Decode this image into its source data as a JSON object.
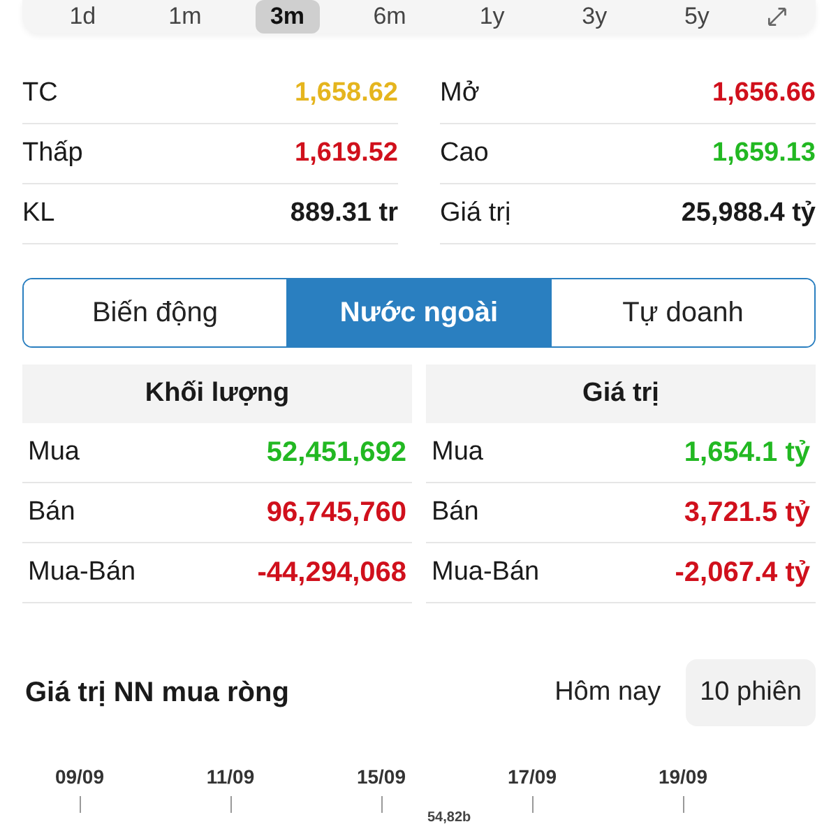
{
  "periods": [
    {
      "label": "1d",
      "selected": false
    },
    {
      "label": "1m",
      "selected": false
    },
    {
      "label": "3m",
      "selected": true
    },
    {
      "label": "6m",
      "selected": false
    },
    {
      "label": "1y",
      "selected": false
    },
    {
      "label": "3y",
      "selected": false
    },
    {
      "label": "5y",
      "selected": false
    }
  ],
  "stats": [
    [
      {
        "label": "TC",
        "value": "1,658.62",
        "color": "#e5b51e"
      },
      {
        "label": "Mở",
        "value": "1,656.66",
        "color": "#d0101c"
      }
    ],
    [
      {
        "label": "Thấp",
        "value": "1,619.52",
        "color": "#d0101c"
      },
      {
        "label": "Cao",
        "value": "1,659.13",
        "color": "#22b822"
      }
    ],
    [
      {
        "label": "KL",
        "value": "889.31 tr",
        "color": "#1a1a1a"
      },
      {
        "label": "Giá trị",
        "value": "25,988.4 tỷ",
        "color": "#1a1a1a"
      }
    ]
  ],
  "tabs": [
    {
      "label": "Biến động",
      "selected": false
    },
    {
      "label": "Nước ngoài",
      "selected": true
    },
    {
      "label": "Tự doanh",
      "selected": false
    }
  ],
  "tables": [
    {
      "title": "Khối lượng",
      "rows": [
        {
          "label": "Mua",
          "value": "52,451,692",
          "color": "#22b822"
        },
        {
          "label": "Bán",
          "value": "96,745,760",
          "color": "#d0101c"
        },
        {
          "label": "Mua-Bán",
          "value": "-44,294,068",
          "color": "#d0101c"
        }
      ]
    },
    {
      "title": "Giá trị",
      "rows": [
        {
          "label": "Mua",
          "value": "1,654.1 tỷ",
          "color": "#22b822"
        },
        {
          "label": "Bán",
          "value": "3,721.5 tỷ",
          "color": "#d0101c"
        },
        {
          "label": "Mua-Bán",
          "value": "-2,067.4 tỷ",
          "color": "#d0101c"
        }
      ]
    }
  ],
  "net_section": {
    "title": "Giá trị NN mua ròng",
    "options": [
      {
        "label": "Hôm nay",
        "selected": false
      },
      {
        "label": "10 phiên",
        "selected": true
      }
    ],
    "dates": [
      "09/09",
      "11/09",
      "15/09",
      "17/09",
      "19/09"
    ],
    "value_label": "54,82b"
  }
}
